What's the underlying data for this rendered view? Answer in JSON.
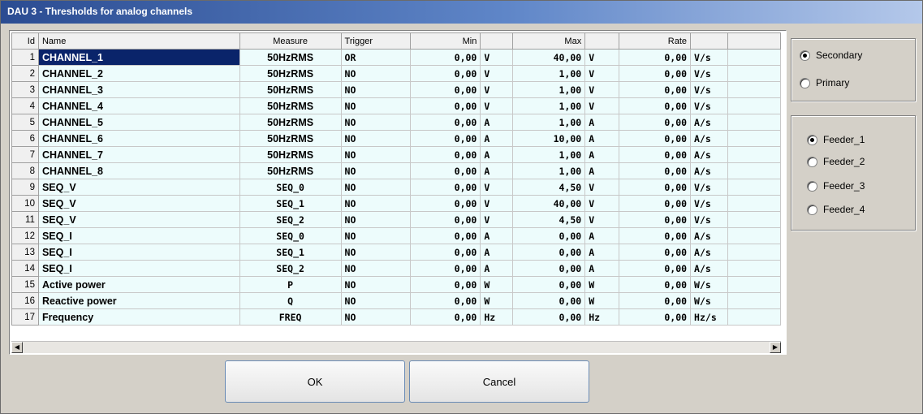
{
  "window": {
    "title": "DAU 3 - Thresholds for analog channels"
  },
  "table": {
    "columns": {
      "id": "Id",
      "name": "Name",
      "measure": "Measure",
      "trigger": "Trigger",
      "min": "Min",
      "max": "Max",
      "rate": "Rate"
    },
    "rows": [
      {
        "id": "1",
        "name": "CHANNEL_1",
        "measure": "50HzRMS",
        "trigger": "OR",
        "min": "0,00",
        "min_unit": "V",
        "max": "40,00",
        "max_unit": "V",
        "rate": "0,00",
        "rate_unit": "V/s"
      },
      {
        "id": "2",
        "name": "CHANNEL_2",
        "measure": "50HzRMS",
        "trigger": "NO",
        "min": "0,00",
        "min_unit": "V",
        "max": "1,00",
        "max_unit": "V",
        "rate": "0,00",
        "rate_unit": "V/s"
      },
      {
        "id": "3",
        "name": "CHANNEL_3",
        "measure": "50HzRMS",
        "trigger": "NO",
        "min": "0,00",
        "min_unit": "V",
        "max": "1,00",
        "max_unit": "V",
        "rate": "0,00",
        "rate_unit": "V/s"
      },
      {
        "id": "4",
        "name": "CHANNEL_4",
        "measure": "50HzRMS",
        "trigger": "NO",
        "min": "0,00",
        "min_unit": "V",
        "max": "1,00",
        "max_unit": "V",
        "rate": "0,00",
        "rate_unit": "V/s"
      },
      {
        "id": "5",
        "name": "CHANNEL_5",
        "measure": "50HzRMS",
        "trigger": "NO",
        "min": "0,00",
        "min_unit": "A",
        "max": "1,00",
        "max_unit": "A",
        "rate": "0,00",
        "rate_unit": "A/s"
      },
      {
        "id": "6",
        "name": "CHANNEL_6",
        "measure": "50HzRMS",
        "trigger": "NO",
        "min": "0,00",
        "min_unit": "A",
        "max": "10,00",
        "max_unit": "A",
        "rate": "0,00",
        "rate_unit": "A/s"
      },
      {
        "id": "7",
        "name": "CHANNEL_7",
        "measure": "50HzRMS",
        "trigger": "NO",
        "min": "0,00",
        "min_unit": "A",
        "max": "1,00",
        "max_unit": "A",
        "rate": "0,00",
        "rate_unit": "A/s"
      },
      {
        "id": "8",
        "name": "CHANNEL_8",
        "measure": "50HzRMS",
        "trigger": "NO",
        "min": "0,00",
        "min_unit": "A",
        "max": "1,00",
        "max_unit": "A",
        "rate": "0,00",
        "rate_unit": "A/s"
      },
      {
        "id": "9",
        "name": "SEQ_V",
        "measure": "SEQ_0",
        "trigger": "NO",
        "min": "0,00",
        "min_unit": "V",
        "max": "4,50",
        "max_unit": "V",
        "rate": "0,00",
        "rate_unit": "V/s"
      },
      {
        "id": "10",
        "name": "SEQ_V",
        "measure": "SEQ_1",
        "trigger": "NO",
        "min": "0,00",
        "min_unit": "V",
        "max": "40,00",
        "max_unit": "V",
        "rate": "0,00",
        "rate_unit": "V/s"
      },
      {
        "id": "11",
        "name": "SEQ_V",
        "measure": "SEQ_2",
        "trigger": "NO",
        "min": "0,00",
        "min_unit": "V",
        "max": "4,50",
        "max_unit": "V",
        "rate": "0,00",
        "rate_unit": "V/s"
      },
      {
        "id": "12",
        "name": "SEQ_I",
        "measure": "SEQ_0",
        "trigger": "NO",
        "min": "0,00",
        "min_unit": "A",
        "max": "0,00",
        "max_unit": "A",
        "rate": "0,00",
        "rate_unit": "A/s"
      },
      {
        "id": "13",
        "name": "SEQ_I",
        "measure": "SEQ_1",
        "trigger": "NO",
        "min": "0,00",
        "min_unit": "A",
        "max": "0,00",
        "max_unit": "A",
        "rate": "0,00",
        "rate_unit": "A/s"
      },
      {
        "id": "14",
        "name": "SEQ_I",
        "measure": "SEQ_2",
        "trigger": "NO",
        "min": "0,00",
        "min_unit": "A",
        "max": "0,00",
        "max_unit": "A",
        "rate": "0,00",
        "rate_unit": "A/s"
      },
      {
        "id": "15",
        "name": "Active power",
        "measure": "P",
        "trigger": "NO",
        "min": "0,00",
        "min_unit": "W",
        "max": "0,00",
        "max_unit": "W",
        "rate": "0,00",
        "rate_unit": "W/s"
      },
      {
        "id": "16",
        "name": "Reactive power",
        "measure": "Q",
        "trigger": "NO",
        "min": "0,00",
        "min_unit": "W",
        "max": "0,00",
        "max_unit": "W",
        "rate": "0,00",
        "rate_unit": "W/s"
      },
      {
        "id": "17",
        "name": "Frequency",
        "measure": "FREQ",
        "trigger": "NO",
        "min": "0,00",
        "min_unit": "Hz",
        "max": "0,00",
        "max_unit": "Hz",
        "rate": "0,00",
        "rate_unit": "Hz/s"
      }
    ]
  },
  "scrollbar": {
    "left_icon": "arrow-left-icon",
    "right_icon": "arrow-right-icon"
  },
  "value_mode": {
    "selected": "Secondary",
    "options": [
      "Secondary",
      "Primary"
    ]
  },
  "feeders": {
    "selected": "Feeder_1",
    "options": [
      "Feeder_1",
      "Feeder_2",
      "Feeder_3",
      "Feeder_4"
    ]
  },
  "buttons": {
    "ok": "OK",
    "cancel": "Cancel"
  }
}
